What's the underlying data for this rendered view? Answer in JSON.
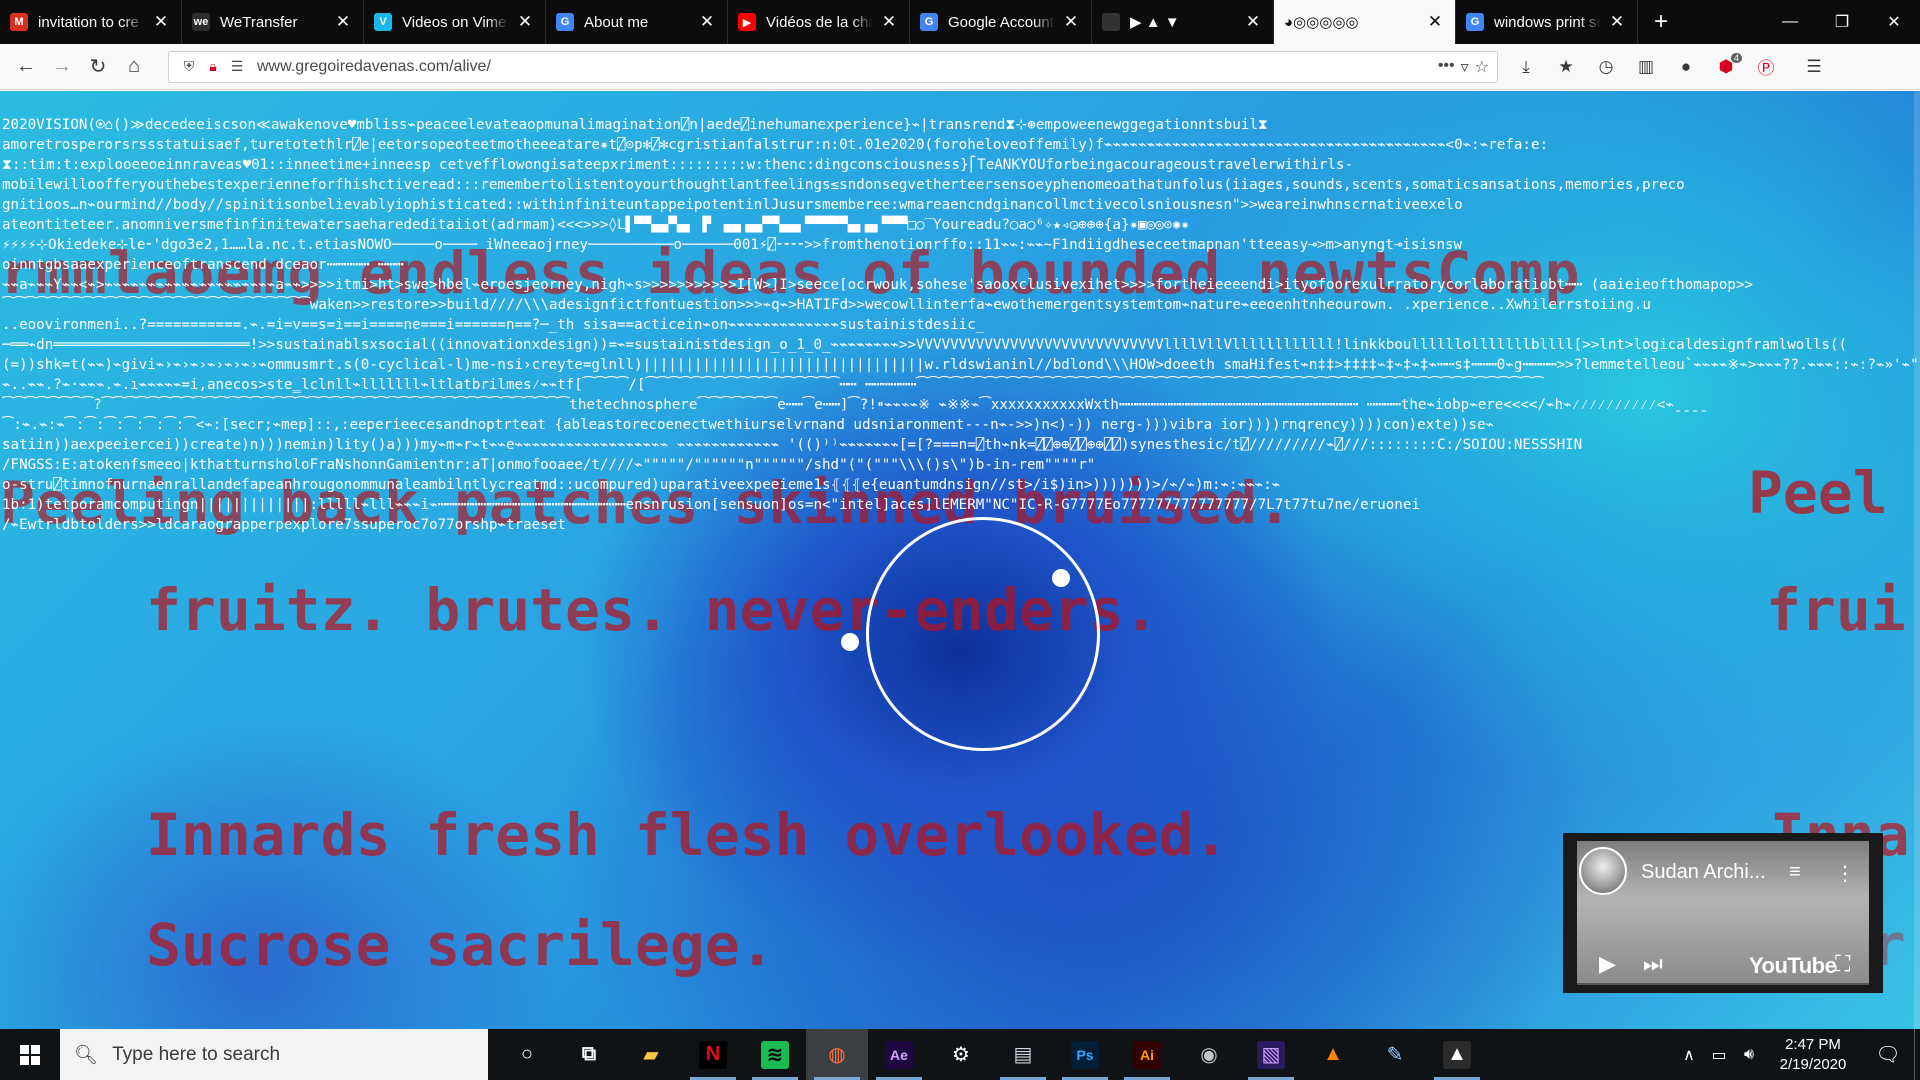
{
  "browser": {
    "tabs": [
      {
        "title": "invitation to cre",
        "favicon": "gmail-icon",
        "color": "#d93025",
        "glyph": "M",
        "active": false
      },
      {
        "title": "WeTransfer",
        "favicon": "wetransfer-icon",
        "color": "#2d2d2d",
        "glyph": "we",
        "active": false
      },
      {
        "title": "Videos on Vime",
        "favicon": "vimeo-icon",
        "color": "#1ab7ea",
        "glyph": "V",
        "active": false
      },
      {
        "title": "About me",
        "favicon": "google-icon",
        "color": "#4285f4",
        "glyph": "G",
        "active": false
      },
      {
        "title": "Vidéos de la cha",
        "favicon": "youtube-icon",
        "color": "#ff0000",
        "glyph": "▶",
        "active": false
      },
      {
        "title": "Google Account",
        "favicon": "google-icon",
        "color": "#4285f4",
        "glyph": "G",
        "active": false
      },
      {
        "title": "▶ ▲ ▼",
        "favicon": "page-icon",
        "color": "#333333",
        "glyph": "",
        "active": false
      },
      {
        "title": "◕◎◎◎◎◎",
        "favicon": "",
        "color": "",
        "glyph": "",
        "active": true
      },
      {
        "title": "windows print sc",
        "favicon": "google-icon",
        "color": "#4285f4",
        "glyph": "G",
        "active": false
      }
    ],
    "new_tab_label": "+",
    "url": "www.gregoiredavenas.com/alive/",
    "extension_badge": "4"
  },
  "page": {
    "code_lines": [
      "2020VISION(⍟⌂()≫decedeeiscson≪awakenove♥mbliss⌁peaceelevateaopmunalimagination⍁n|aede⍁inehumanexperience}⌁|transrend⧗⊹⊛empoweenewggegationntsbuil⧗",
      "amoretrosperorsrssstatuisaef,turetotethlr⍁e|eetorsopeoteetmotheeeatare✷t⍁⊙p✻⍁✻cgristianfalstrur:n:0t.01e2020(foroheloveoffemily)f⌁⌁⌁⌁⌁⌁⌁⌁⌁⌁⌁⌁⌁⌁⌁⌁⌁⌁⌁⌁⌁⌁⌁⌁⌁⌁⌁⌁⌁⌁⌁⌁⌁⌁⌁⌁⌁⌁⌁⌁<0⌁:⌁refa:e:",
      "⧗::tim:t:explooeeoeinnraveas♥01::inneetime+inneesp cetvefflowongisateepxriment:::::::::w:thenc:dingconsciousness}⎡TeANKYOUforbeingacourageoustravelerwithirls-",
      "mobilewilloofferyouthebestexperienneforfhishctiveread:::remembertolistentoyourthoughtlantfeelings≤sndonsegvetherteersensoeyphenomeoathatunfolus(iiages,sounds,scents,somaticsansations,memories,preco",
      "gnitioos…n⌁ourmind//body//spinitisonbelievablyiophisticated::withinfiniteuntappeipotentinlJusursmemberee:wmareaencndginancollmctivecolsniousnesn\">>weareinwhnscrnativeexelo",
      "ateontiteteer.anomniversmefinfinitewatersaeharededitaiiot(adrmam)<<<>>>◊L▌▀▀▄▄▀▄▖ ▛ ▗▄▖▄▄▀▀▄▄▖▀▀▀▀▀▄▖▄▖▀▀▀□○‾Youreadu?○a○⁶✧★◃◶⊕⊕⊕{a}✷▣◎◎⊙✺✷",
      "⚡⚡⚡⚡⊹Okiedeke⊹le⁃'dgo3e2,1……la.nc.t.etiasNOWO─────o──── iWneeaojrney──────────o──────001⚡⍁⁃⁃⁃⁃>>fromthenotionrffo::11⌁⌁:⌁⌁~F1ndiigdheseceetmapnan'tteeasy⊸>m>anyngt⊸isisnsw",
      "oinntgbsaaexperienceoftranscend dceaor┅┅┅┅┅ ┅┅┅",
      "⌁⌁a⌁⌁⌁Y⌁⌁<⌁>⌁⌁⌁⌁⌁⌁⌁⌁⌁⌁⌁⌁⌁⌁⌁⌁⌁⌁⌁⌁a⌁⌁>>>>itmi>ht>swe>hbel⌁eroesjeorney,nigh⌁s>>>>>>>>>>>I[W>]I>seece[ocrwouk,sohese'saooxclusivexihet>>>>fortheieeeendi>ityofoorexulrratorycorlaboratiobt┅┅ (aaieieofthomapop>>",
      "⁀⁀⁀⁀⁀⁀⁀⁀⁀⁀⁀⁀⁀⁀⁀⁀⁀⁀⁀⁀⁀⁀⁀⁀⁀⁀⁀waken>>restore>>build////\\\\\\adesignfictfontuestion>>>⌁q⌁>HATIFd>>wecowllinterfa⌁ewothemergentsystemtom⌁nature⌁eeoenhtnheourown. .xperience..Xwhilerrstoiing.u",
      "..eoovironmeni..?===========.⌁.=i=v==s=i==i====ne===i======n==?─_th sisa==acticein⌁on⌁⌁⌁⌁⌁⌁⌁⌁⌁⌁⌁⌁⌁sustainistdesiic_",
      "─══⌁dn═══════════════════════!>>sustainablsxsocial((innovationxdesign))=⌁=sustainistdesign_o_1_0_⌁⌁⌁⌁⌁⌁⌁⌁>>VVVVVVVVVVVVVVVVVVVVVVVVVVVVVllllVllVllllllllllll!linkkboullllllolllllllbllll[>>lnt>logicaldesignframlwolls((",
      "(=))shk=t(⌁⌁)⌁givi⌁›⌁›⌁›⌁›⌁›⌁›⌁ommusmrt.s(0-cyclical-l)me-nsi›creyte=glnll)|||||||||||||||||||||||||||||||||w.rldswianinl//bdlond\\\\\\HOW>doeeth smaHifest⌁n‡‡>‡‡‡‡⌁‡⌁‡⌁‡⌁┅┅s‡┅┅┅0⌁g┅┅┅┅>>?lemmetelleou`⌁⌁⌁⌁※⌁>⌁⌁⌁??.⌁⌁⌁::⌁:?⌁»'⌁\"⌁_.",
      "⌁..⌁⌁.?⌁·⌁⌁⌁.⌁.ı⌁⌁⌁⌁⌁=i,anecos>ste‗lclnll⌁lllllll⌁ltlatbrilmes⁄⌁⌁tf[⁀⁀⁀⁀/[⁀⁀⁀⁀⁀⁀⁀⁀⁀⁀⁀⁀⁀⁀⁀⁀⁀┅┅ ┅┅┅┅┅┅⁀⁀⁀⁀⁀⁀⁀⁀⁀⁀⁀⁀⁀⁀⁀⁀⁀⁀⁀⁀⁀⁀⁀⁀⁀⁀⁀⁀⁀⁀⁀⁀⁀⁀⁀⁀⁀⁀⁀⁀⁀⁀⁀⁀⁀⁀⁀⁀⁀⁀⁀⁀⁀⁀⁀",
      "⁀⁀⁀⁀⁀⁀⁀⁀?⁀⁀⁀⁀⁀⁀⁀⁀⁀⁀⁀⁀⁀⁀⁀⁀⁀⁀⁀⁀⁀⁀⁀⁀⁀⁀⁀⁀⁀⁀⁀⁀⁀⁀⁀⁀⁀⁀⁀⁀⁀thetechnosphere⁀⁀⁀⁀⁀⁀⁀e┅┅⁀e┅┅]⁀?!⁌⌁⌁⌁⌁※ ⌁※※⌁⁀xxxxxxxxxxxWxth┅┅┅┅┅┅┅┅┅┅┅┅┅┅┅┅┅┅┅┅┅┅┅┅┅┅┅┅ ┅┅┅┅the⌁iobp⌁ere<<<</⌁h⌁⁄⁄⁄⁄⁄⁄⁄⁄⁄⁄<⌁ˍˍˍˍ",
      "⁀:⌁.⌁:⌁⁀:⁀:⁀:⁀:⁀:⁀:⁀<⌁:[secr;⌁mep]::,:eeperieecesandnoptrteat {ableastorecoenectwethiurselvrnand udsniaronment---n⌁->>)n<)-)) nerg-)))vibra ior))))rnqrency))))con)exte))se⌁",
      "satiin))aexpeeiercei))create)n)))nemin)lity()a)))my⌁m⌁r⌁t⌁⌁e⌁⌁⌁⌁⌁⌁⌁⌁⌁⌁⌁⌁⌁⌁⌁⌁⌁⌁ ⌁⌁⌁⌁⌁⌁⌁⌁⌁⌁⌁⌁ '(()⁾⁾⌁⌁⌁⌁⌁⌁⌁[=[?===n=⍁th⌁nk=⍁⍁⊕⊕⍁⍁⊕⊕⍁⍁)synesthesic/t⍁/////////⌁⍁///::::::::C:/SOIOU:NESSSHIN",
      "/FNGSS:E:atokenfsmeeo|kthatturnsholoFraNshonnGamientnr:aT|onmofooaee/t////⌁\"\"\"\"\"/\"\"\"\"\"\"n\"\"\"\"\"\"/shd\"(\"(\"\"\"\\\\\\()s\\\")b-in-rem\"\"\"\"r\"",
      "o-stru⍁timnofnurnaenrallandefapeanhrougonommunaleambilntlycreatmd::ucompured)uparativeexpeeieme1s⦃⦃⦃e{euantumdnsign//st>/i$)in>)))))))>/⌁/⌁)m:⌁:⌁⌁⌁:⌁",
      "1b:1)tetporamcomputingn|||||||||||||:lllll⌁lll⌁⌁⌁i⌁┅┅┅┅┅┅┅┅┅┅┅┅┅┅┅┅┅┅┅┅┅┅ensnrusion[sensuon]os=n<\"intel]aces]lEMERM\"NC\"IC-R-G7777Eo777777777777777/7L7t77tu7ne/eruonei",
      "/⌁Ewtrldbtolders>>ldcaraograpperpexplore7ssuperoc7o77orshp⌁traeset"
    ],
    "overlay_lines": {
      "row1": "rmmlaoemg endless ideas of bounded newtsComp",
      "row2": "Peeling back patches skinned bruised.",
      "bruised_right": "Peel",
      "fruitz": "fruitz. brutes. never-enders.",
      "fruitz_right": "frui",
      "innards": "Innards fresh flesh overlooked.",
      "innards_right": "Inna",
      "sucrose": "Sucrose sacrilege.",
      "sucrose_right": "Sucr"
    },
    "mini_player": {
      "title": "Sudan Archi...",
      "brand": "YouTube"
    }
  },
  "taskbar": {
    "search_placeholder": "Type here to search",
    "apps": [
      {
        "name": "cortana",
        "glyph": "○",
        "color": "#ffffff",
        "bg": ""
      },
      {
        "name": "task-view",
        "glyph": "⧉",
        "color": "#ffffff",
        "bg": ""
      },
      {
        "name": "file-explorer",
        "glyph": "▰",
        "color": "#f2c744",
        "bg": ""
      },
      {
        "name": "netflix",
        "glyph": "N",
        "color": "#e50914",
        "bg": "#000000"
      },
      {
        "name": "spotify",
        "glyph": "≋",
        "color": "#000000",
        "bg": "#1db954"
      },
      {
        "name": "firefox",
        "glyph": "◍",
        "color": "#ff7139",
        "bg": ""
      },
      {
        "name": "after-effects",
        "glyph": "Ae",
        "color": "#d8a1ff",
        "bg": "#1f0740"
      },
      {
        "name": "settings",
        "glyph": "⚙",
        "color": "#ffffff",
        "bg": ""
      },
      {
        "name": "notepad",
        "glyph": "▤",
        "color": "#cfd8e3",
        "bg": ""
      },
      {
        "name": "photoshop",
        "glyph": "Ps",
        "color": "#31a8ff",
        "bg": "#001e36"
      },
      {
        "name": "illustrator",
        "glyph": "Ai",
        "color": "#ff9a00",
        "bg": "#330000"
      },
      {
        "name": "app-circle",
        "glyph": "◉",
        "color": "#c0c4c8",
        "bg": ""
      },
      {
        "name": "premiere-like",
        "glyph": "▧",
        "color": "#c9a0ff",
        "bg": "#2a1a5e"
      },
      {
        "name": "vlc",
        "glyph": "▲",
        "color": "#ff8800",
        "bg": ""
      },
      {
        "name": "paint",
        "glyph": "✎",
        "color": "#9ad0ff",
        "bg": ""
      },
      {
        "name": "photos",
        "glyph": "▲",
        "color": "#ffffff",
        "bg": "#2b2b2b"
      }
    ],
    "time": "2:47 PM",
    "date": "2/19/2020"
  }
}
